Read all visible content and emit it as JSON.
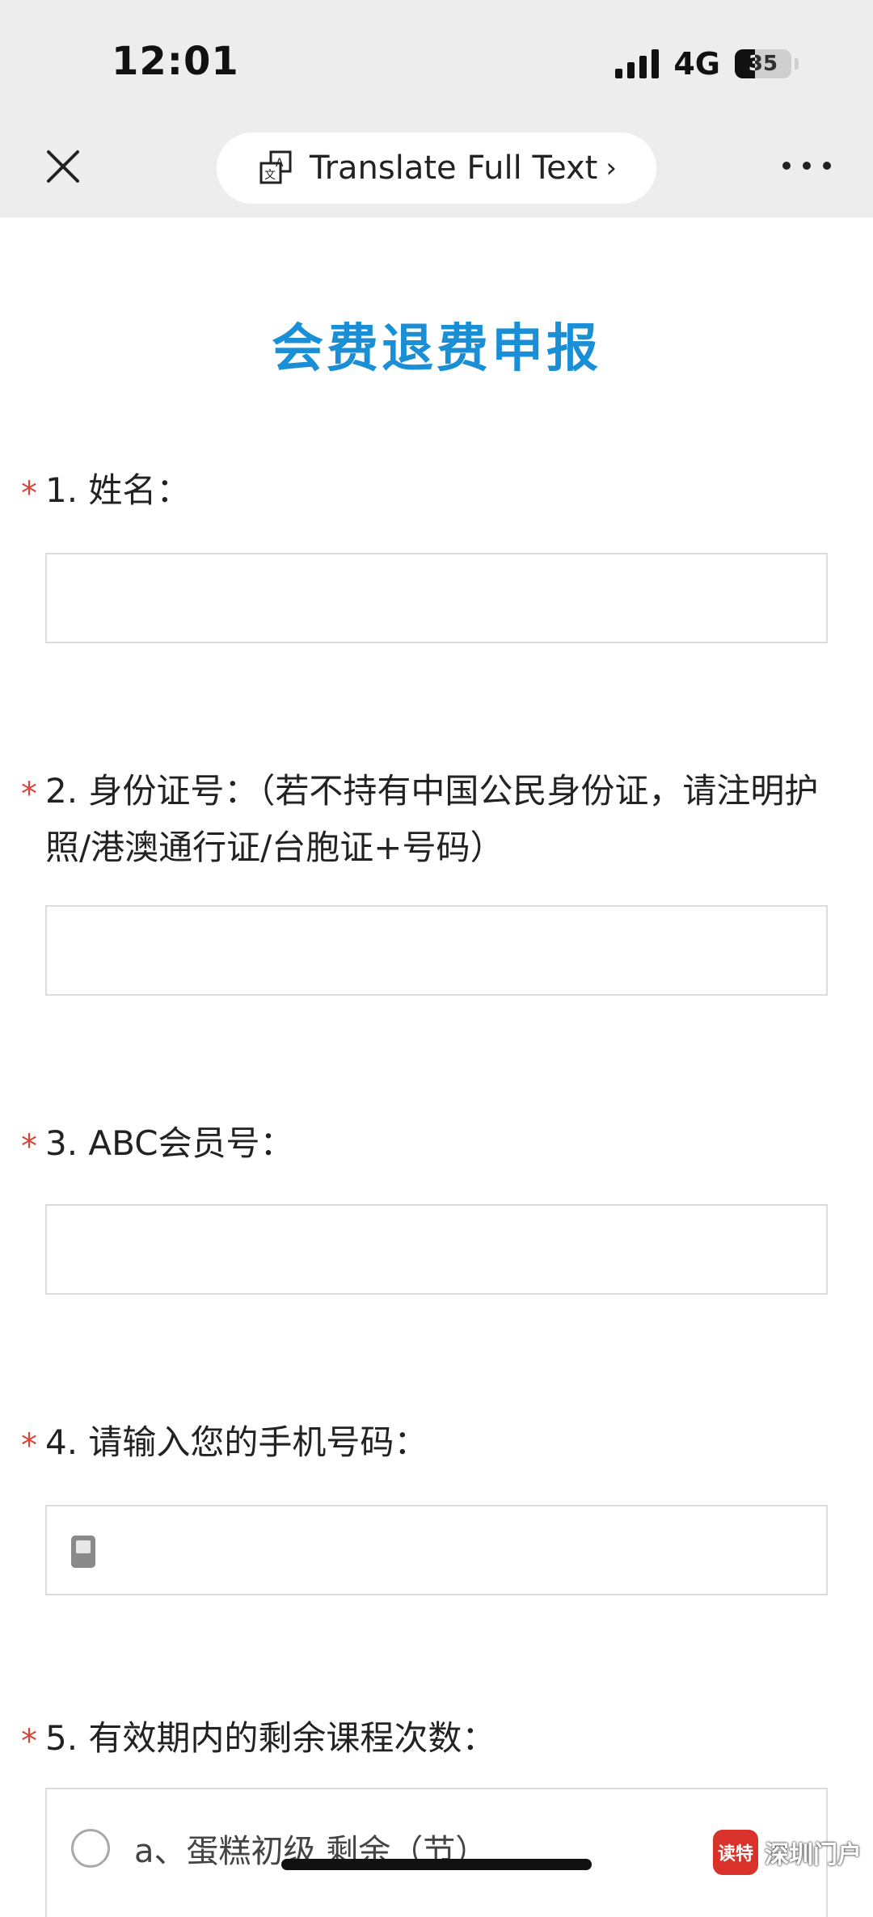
{
  "status_bar": {
    "time": "12:01",
    "network": "4G",
    "battery": "35"
  },
  "header": {
    "translate_label": "Translate Full Text",
    "chevron": "›",
    "close_icon": "close-icon",
    "translate_icon": "translate-icon",
    "more_icon": "more-dots-icon"
  },
  "form": {
    "title": "会费退费申报",
    "questions": [
      {
        "label": "1. 姓名：",
        "required_mark": "*",
        "value": ""
      },
      {
        "label": "2. 身份证号：（若不持有中国公民身份证，请注明护照/港澳通行证/台胞证+号码）",
        "required_mark": "*",
        "value": ""
      },
      {
        "label": "3. ABC会员号：",
        "required_mark": "*",
        "value": ""
      },
      {
        "label": "4. 请输入您的手机号码：",
        "required_mark": "*",
        "value": ""
      },
      {
        "label": "5. 有效期内的剩余课程次数：",
        "required_mark": "*"
      }
    ],
    "options": [
      {
        "label": "a、蛋糕初级 剩余（节）"
      }
    ]
  },
  "watermark": {
    "logo_text": "读特",
    "text": "深圳门户"
  },
  "colors": {
    "title": "#1a8fd6",
    "required": "#d9453a",
    "header_bg": "#ededed"
  }
}
